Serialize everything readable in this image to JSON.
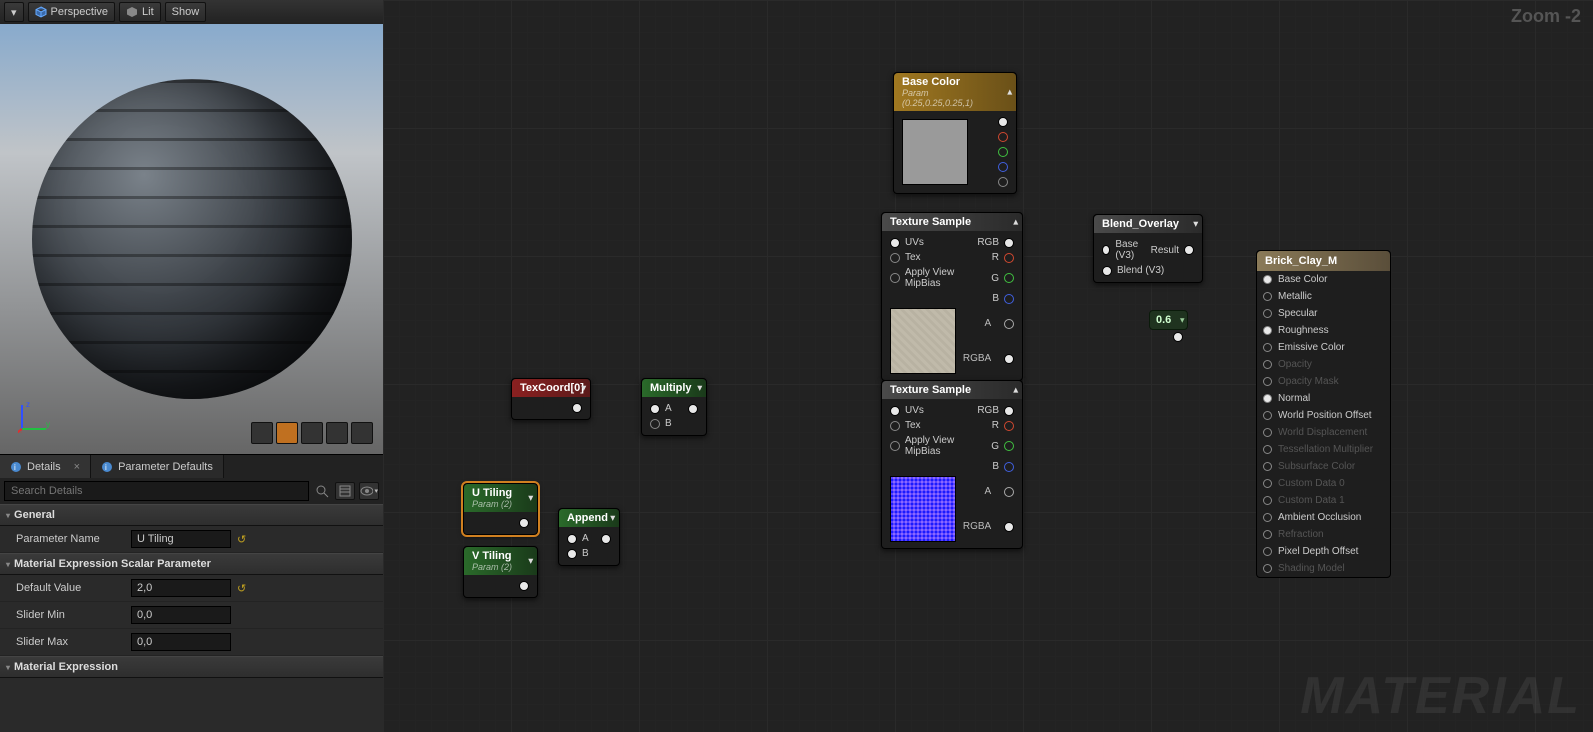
{
  "toolbar": {
    "perspective": "Perspective",
    "lit": "Lit",
    "show": "Show"
  },
  "tabs": {
    "details": "Details",
    "param_defaults": "Parameter Defaults"
  },
  "search": {
    "placeholder": "Search Details"
  },
  "details": {
    "section_general": "General",
    "param_name_label": "Parameter Name",
    "param_name_value": "U Tiling",
    "section_scalar": "Material Expression Scalar Parameter",
    "default_value_label": "Default Value",
    "default_value": "2,0",
    "slider_min_label": "Slider Min",
    "slider_min": "0,0",
    "slider_max_label": "Slider Max",
    "slider_max": "0,0",
    "section_matexp": "Material Expression"
  },
  "zoom": "Zoom -2",
  "watermark": "MATERIAL",
  "nodes": {
    "texcoord": {
      "title": "TexCoord[0]"
    },
    "multiply": {
      "title": "Multiply",
      "a": "A",
      "b": "B"
    },
    "append": {
      "title": "Append",
      "a": "A",
      "b": "B"
    },
    "utiling": {
      "title": "U Tiling",
      "sub": "Param (2)"
    },
    "vtiling": {
      "title": "V Tiling",
      "sub": "Param (2)"
    },
    "basecolor": {
      "title": "Base Color",
      "sub": "Param (0.25,0.25,0.25,1)"
    },
    "tex1": {
      "title": "Texture Sample",
      "uvs": "UVs",
      "tex": "Tex",
      "mip": "Apply View MipBias",
      "rgb": "RGB",
      "r": "R",
      "g": "G",
      "b": "B",
      "a": "A",
      "rgba": "RGBA"
    },
    "tex2": {
      "title": "Texture Sample",
      "uvs": "UVs",
      "tex": "Tex",
      "mip": "Apply View MipBias",
      "rgb": "RGB",
      "r": "R",
      "g": "G",
      "b": "B",
      "a": "A",
      "rgba": "RGBA"
    },
    "blend": {
      "title": "Blend_Overlay",
      "base": "Base (V3)",
      "blend": "Blend (V3)",
      "result": "Result"
    },
    "const": {
      "value": "0.6"
    }
  },
  "result": {
    "title": "Brick_Clay_M",
    "rows": [
      {
        "label": "Base Color",
        "enabled": true,
        "connected": true
      },
      {
        "label": "Metallic",
        "enabled": true,
        "connected": false
      },
      {
        "label": "Specular",
        "enabled": true,
        "connected": false
      },
      {
        "label": "Roughness",
        "enabled": true,
        "connected": true
      },
      {
        "label": "Emissive Color",
        "enabled": true,
        "connected": false
      },
      {
        "label": "Opacity",
        "enabled": false,
        "connected": false
      },
      {
        "label": "Opacity Mask",
        "enabled": false,
        "connected": false
      },
      {
        "label": "Normal",
        "enabled": true,
        "connected": true
      },
      {
        "label": "World Position Offset",
        "enabled": true,
        "connected": false
      },
      {
        "label": "World Displacement",
        "enabled": false,
        "connected": false
      },
      {
        "label": "Tessellation Multiplier",
        "enabled": false,
        "connected": false
      },
      {
        "label": "Subsurface Color",
        "enabled": false,
        "connected": false
      },
      {
        "label": "Custom Data 0",
        "enabled": false,
        "connected": false
      },
      {
        "label": "Custom Data 1",
        "enabled": false,
        "connected": false
      },
      {
        "label": "Ambient Occlusion",
        "enabled": true,
        "connected": false
      },
      {
        "label": "Refraction",
        "enabled": false,
        "connected": false
      },
      {
        "label": "Pixel Depth Offset",
        "enabled": true,
        "connected": false
      },
      {
        "label": "Shading Model",
        "enabled": false,
        "connected": false
      }
    ]
  }
}
